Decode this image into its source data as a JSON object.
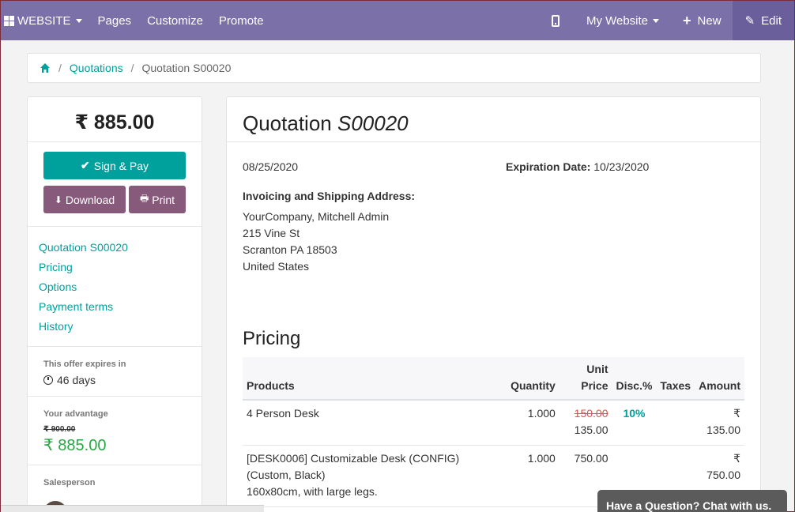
{
  "navbar": {
    "brand": "WEBSITE",
    "items": [
      "Pages",
      "Customize",
      "Promote"
    ],
    "website_selector": "My Website",
    "new_label": "New",
    "edit_label": "Edit"
  },
  "breadcrumb": {
    "parent": "Quotations",
    "current": "Quotation S00020"
  },
  "sidebar": {
    "total": "₹ 885.00",
    "sign_pay_label": "Sign & Pay",
    "download_label": "Download",
    "print_label": "Print",
    "links": [
      "Quotation S00020",
      "Pricing",
      "Options",
      "Payment terms",
      "History"
    ],
    "expires_label": "This offer expires in",
    "expires_value": "46 days",
    "advantage_label": "Your advantage",
    "old_price": "₹ 900.00",
    "advantage_price": "₹ 885.00",
    "salesperson_label": "Salesperson"
  },
  "quotation": {
    "title_prefix": "Quotation",
    "title_ref": "S00020",
    "date": "08/25/2020",
    "expiration_label": "Expiration Date:",
    "expiration_date": "10/23/2020",
    "address_title": "Invoicing and Shipping Address:",
    "address_lines": [
      "YourCompany, Mitchell Admin",
      "215 Vine St",
      "Scranton PA 18503",
      "United States"
    ],
    "pricing_title": "Pricing"
  },
  "table": {
    "headers": {
      "products": "Products",
      "quantity": "Quantity",
      "unit_price_1": "Unit",
      "unit_price_2": "Price",
      "disc": "Disc.%",
      "taxes": "Taxes",
      "amount": "Amount"
    },
    "rows": [
      {
        "product": "4 Person Desk",
        "quantity": "1.000",
        "old_price": "150.00",
        "unit_price": "135.00",
        "disc": "10%",
        "taxes": "",
        "amount": "₹ 135.00"
      },
      {
        "product": "[DESK0006] Customizable Desk (CONFIG) (Custom, Black)",
        "product_note": "160x80cm, with large legs.",
        "quantity": "1.000",
        "unit_price": "750.00",
        "disc": "",
        "taxes": "",
        "amount": "₹ 750.00"
      }
    ]
  },
  "chat": {
    "label": "Have a Question? Chat with us."
  }
}
